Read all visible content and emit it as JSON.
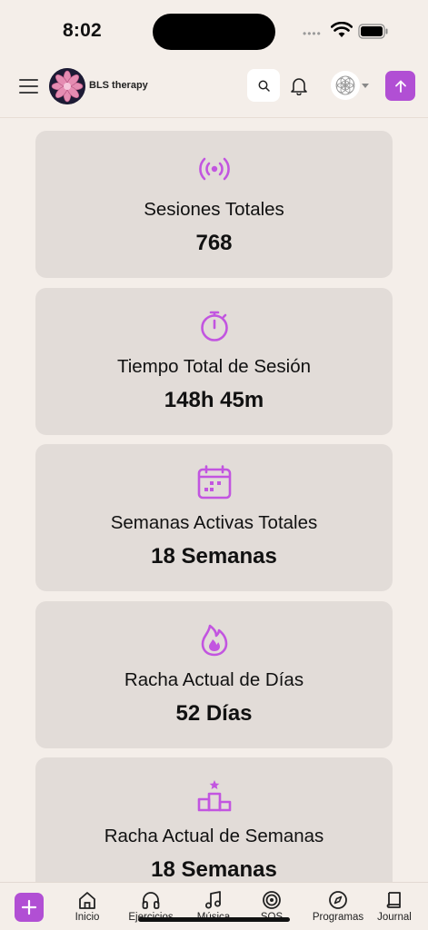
{
  "status_bar": {
    "time": "8:02",
    "dots": "••••"
  },
  "header": {
    "brand": "BLS therapy"
  },
  "cards": [
    {
      "title": "Sesiones Totales",
      "value": "768",
      "icon": "broadcast-icon"
    },
    {
      "title": "Tiempo Total de Sesión",
      "value": "148h 45m",
      "icon": "stopwatch-icon"
    },
    {
      "title": "Semanas Activas Totales",
      "value": "18 Semanas",
      "icon": "calendar-icon"
    },
    {
      "title": "Racha Actual de Días",
      "value": "52 Días",
      "icon": "flame-icon"
    },
    {
      "title": "Racha Actual de Semanas",
      "value": "18 Semanas",
      "icon": "podium-icon"
    }
  ],
  "nav": {
    "items": [
      {
        "label": "Inicio",
        "icon": "home-icon"
      },
      {
        "label": "Ejercicios",
        "icon": "headphones-icon"
      },
      {
        "label": "Música",
        "icon": "music-icon"
      },
      {
        "label": "SOS",
        "icon": "target-icon"
      },
      {
        "label": "Programas",
        "icon": "compass-icon"
      },
      {
        "label": "Journal",
        "icon": "book-icon"
      }
    ]
  },
  "colors": {
    "accent": "#b14fd4",
    "card": "#e2dcd8",
    "background": "#f4eee9"
  }
}
